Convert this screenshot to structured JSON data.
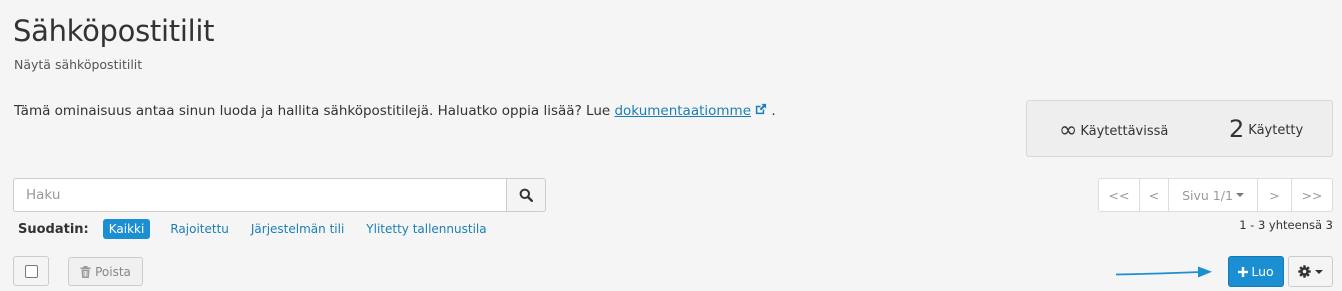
{
  "header": {
    "title": "Sähköpostitilit",
    "subtitle": "Näytä sähköpostitilit"
  },
  "intro": {
    "text": "Tämä ominaisuus antaa sinun luoda ja hallita sähköpostitilejä. Haluatko oppia lisää? Lue ",
    "link_text": "dokumentaatiomme",
    "suffix": " ."
  },
  "stats": {
    "available_symbol": "∞",
    "available_label": "Käytettävissä",
    "used_value": "2",
    "used_label": "Käytetty"
  },
  "search": {
    "placeholder": "Haku",
    "value": ""
  },
  "pagination": {
    "first": "<<",
    "prev": "<",
    "page": "Sivu 1/1",
    "next": ">",
    "last": ">>",
    "results": "1 - 3 yhteensä 3"
  },
  "filters": {
    "label": "Suodatin:",
    "items": [
      "Kaikki",
      "Rajoitettu",
      "Järjestelmän tili",
      "Ylitetty tallennustila"
    ],
    "active_index": 0
  },
  "toolbar": {
    "delete_label": "Poista",
    "create_label": "Luo"
  },
  "colors": {
    "primary": "#1b8fd1",
    "link": "#1b7fb5",
    "background": "#f5f5f5"
  },
  "icons": {
    "search": "search-icon",
    "external_link": "external-link-icon",
    "trash": "trash-icon",
    "plus": "plus-icon",
    "gear": "gear-icon"
  }
}
